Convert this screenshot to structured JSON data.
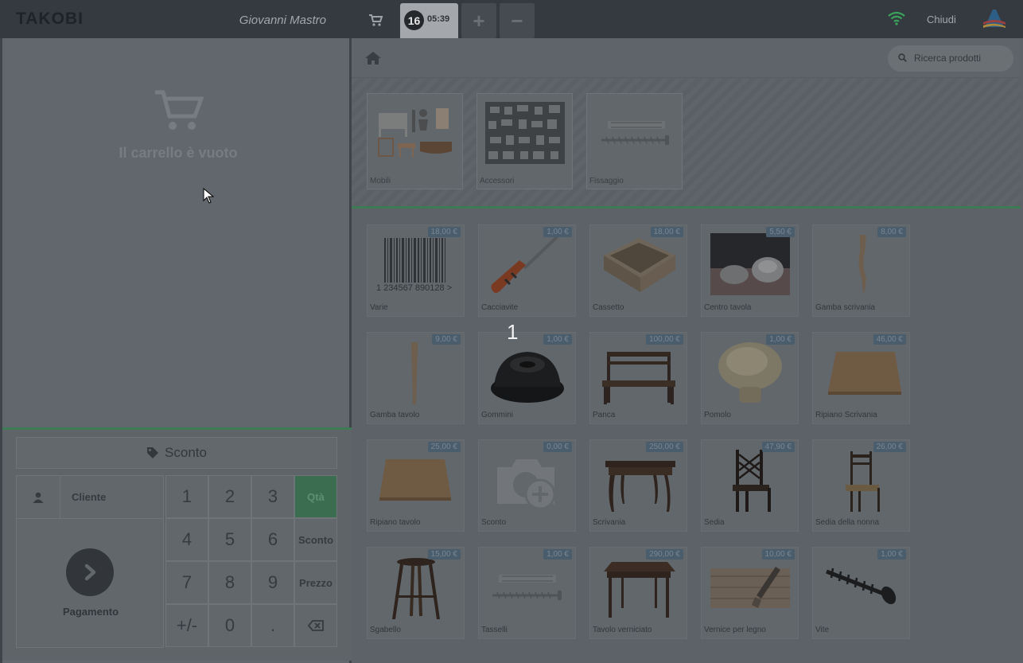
{
  "header": {
    "logo": "TAKOBI",
    "cashier": "Giovanni Mastro",
    "order_number": "16",
    "order_time": "05:39",
    "add_label": "+",
    "remove_label": "−",
    "close_label": "Chiudi",
    "wifi_color": "#3aa35a"
  },
  "cart": {
    "empty_text": "Il carrello è vuoto"
  },
  "controls": {
    "discount_button": "Sconto",
    "customer_button": "Cliente",
    "payment_button": "Pagamento",
    "keys": {
      "k1": "1",
      "k2": "2",
      "k3": "3",
      "qty": "Qtà",
      "k4": "4",
      "k5": "5",
      "k6": "6",
      "disc": "Sconto",
      "k7": "7",
      "k8": "8",
      "k9": "9",
      "price": "Prezzo",
      "sign": "+/-",
      "k0": "0",
      "dot": "."
    }
  },
  "search": {
    "placeholder": "Ricerca prodotti"
  },
  "categories": [
    {
      "name": "Mobili"
    },
    {
      "name": "Accessori"
    },
    {
      "name": "Fissaggio"
    }
  ],
  "products": [
    {
      "name": "Varie",
      "price": "18,00 €"
    },
    {
      "name": "Cacciavite",
      "price": "1,00 €"
    },
    {
      "name": "Cassetto",
      "price": "18,00 €"
    },
    {
      "name": "Centro tavola",
      "price": "5,50 €"
    },
    {
      "name": "Gamba scrivania",
      "price": "8,00 €"
    },
    {
      "name": "Gamba tavolo",
      "price": "9,00 €"
    },
    {
      "name": "Gommini",
      "price": "1,00 €"
    },
    {
      "name": "Panca",
      "price": "100,00 €"
    },
    {
      "name": "Pomolo",
      "price": "1,00 €"
    },
    {
      "name": "Ripiano Scrivania",
      "price": "46,00 €"
    },
    {
      "name": "Ripiano tavolo",
      "price": "25,00 €"
    },
    {
      "name": "Sconto",
      "price": "0,00 €"
    },
    {
      "name": "Scrivania",
      "price": "250,00 €"
    },
    {
      "name": "Sedia",
      "price": "47,90 €"
    },
    {
      "name": "Sedia della nonna",
      "price": "26,00 €"
    },
    {
      "name": "Sgabello",
      "price": "15,00 €"
    },
    {
      "name": "Tasselli",
      "price": "1,00 €"
    },
    {
      "name": "Tavolo verniciato",
      "price": "290,00 €"
    },
    {
      "name": "Vernice per legno",
      "price": "10,00 €"
    },
    {
      "name": "Vite",
      "price": "1,00 €"
    }
  ],
  "barcode_digits": "1 234567 890128 >",
  "qty_feedback": "1"
}
